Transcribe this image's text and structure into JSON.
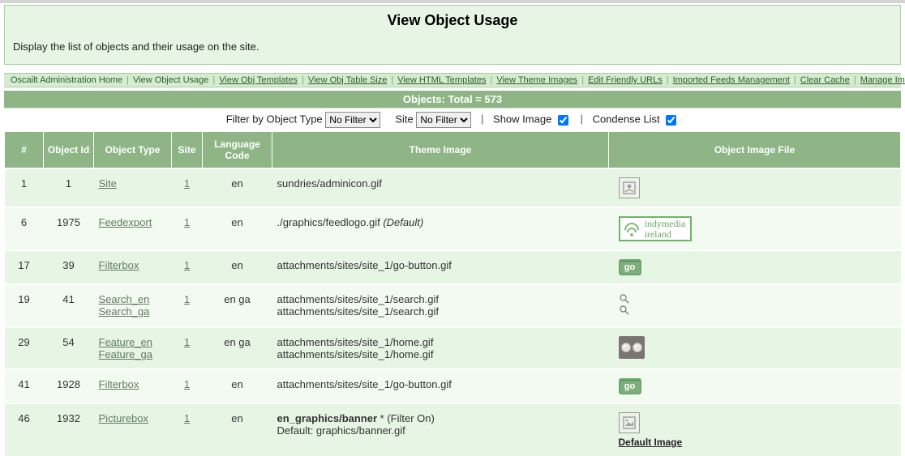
{
  "header": {
    "title": "View Object Usage",
    "subtitle": "Display the list of objects and their usage on the site."
  },
  "nav": {
    "items": [
      {
        "label": "Oscailt Administration Home",
        "underline": false
      },
      {
        "label": "View Object Usage",
        "underline": false
      },
      {
        "label": "View Obj Templates",
        "underline": true
      },
      {
        "label": "View Obj Table Size",
        "underline": true
      },
      {
        "label": "View HTML Templates",
        "underline": true
      },
      {
        "label": "View Theme Images",
        "underline": true
      },
      {
        "label": "Edit Friendly URLs",
        "underline": true
      },
      {
        "label": "Imported Feeds Management",
        "underline": true
      },
      {
        "label": "Clear Cache",
        "underline": true
      },
      {
        "label": "Manage Images",
        "underline": true
      }
    ]
  },
  "totals": {
    "text": "Objects: Total = 573"
  },
  "filters": {
    "type_label": "Filter by Object Type",
    "type_value": "No Filter",
    "site_label": "Site",
    "site_value": "No Filter",
    "show_image_label": "Show Image",
    "show_image_checked": true,
    "condense_label": "Condense List",
    "condense_checked": true
  },
  "columns": {
    "c0": "#",
    "c1": "Object Id",
    "c2": "Object Type",
    "c3": "Site",
    "c4": "Language Code",
    "c5": "Theme Image",
    "c6": "Object Image File"
  },
  "rows": [
    {
      "num": "1",
      "obj_id": "1",
      "type_links": [
        "Site"
      ],
      "site": "1",
      "lang": "en",
      "theme_html": "sundries/adminicon.gif",
      "img_style": "admin-icon"
    },
    {
      "num": "6",
      "obj_id": "1975",
      "type_links": [
        "Feedexport"
      ],
      "site": "1",
      "lang": "en",
      "theme_html": "./graphics/feedlogo.gif <span class=\"ital\">(Default)</span>",
      "img_style": "indymedia"
    },
    {
      "num": "17",
      "obj_id": "39",
      "type_links": [
        "Filterbox"
      ],
      "site": "1",
      "lang": "en",
      "theme_html": "attachments/sites/site_1/go-button.gif",
      "img_style": "go"
    },
    {
      "num": "19",
      "obj_id": "41",
      "type_links": [
        "Search_en",
        "Search_ga"
      ],
      "site": "1",
      "lang": "en ga",
      "theme_html": "attachments/sites/site_1/search.gif<br>attachments/sites/site_1/search.gif",
      "img_style": "magnifier"
    },
    {
      "num": "29",
      "obj_id": "54",
      "type_links": [
        "Feature_en",
        "Feature_ga"
      ],
      "site": "1",
      "lang": "en ga",
      "theme_html": "attachments/sites/site_1/home.gif<br>attachments/sites/site_1/home.gif",
      "img_style": "feature"
    },
    {
      "num": "41",
      "obj_id": "1928",
      "type_links": [
        "Filterbox"
      ],
      "site": "1",
      "lang": "en",
      "theme_html": "attachments/sites/site_1/go-button.gif",
      "img_style": "go"
    },
    {
      "num": "46",
      "obj_id": "1932",
      "type_links": [
        "Picturebox"
      ],
      "site": "1",
      "lang": "en",
      "theme_html": "<span class=\"bld\">en_graphics/banner</span> * (Filter On)<br>Default: graphics/banner.gif",
      "img_style": "picture",
      "caption": "Default Image"
    }
  ]
}
